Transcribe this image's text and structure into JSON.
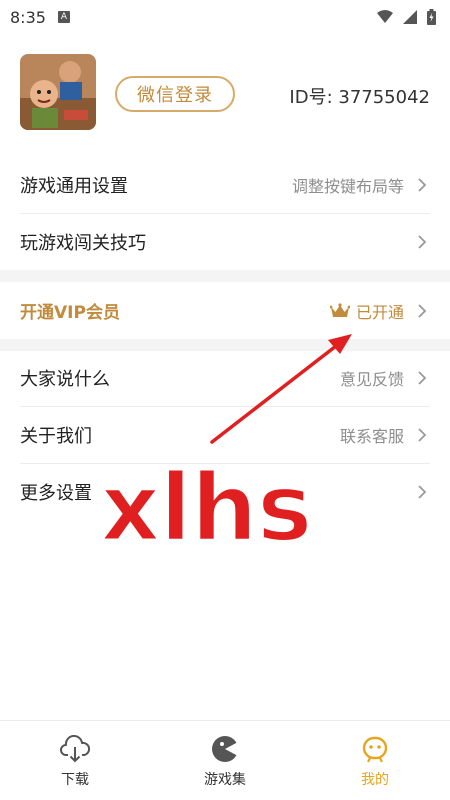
{
  "status_bar": {
    "time": "8:35",
    "notification_glyph": "A"
  },
  "profile": {
    "login_button": "微信登录",
    "user_id": "ID号: 37755042"
  },
  "menu": {
    "game_settings": {
      "label": "游戏通用设置",
      "value": "调整按键布局等"
    },
    "game_tips": {
      "label": "玩游戏闯关技巧",
      "value": ""
    },
    "vip": {
      "label": "开通VIP会员",
      "value": "已开通"
    },
    "feedback": {
      "label": "大家说什么",
      "value": "意见反馈"
    },
    "about": {
      "label": "关于我们",
      "value": "联系客服"
    },
    "more": {
      "label": "更多设置",
      "value": ""
    }
  },
  "watermark": "xlhs",
  "tabs": [
    {
      "label": "下载",
      "icon": "cloud-download-icon",
      "active": false
    },
    {
      "label": "游戏集",
      "icon": "game-collection-icon",
      "active": false
    },
    {
      "label": "我的",
      "icon": "profile-face-icon",
      "active": true
    }
  ],
  "colors": {
    "accent_gold": "#c28b3c",
    "tab_active": "#e6a51d",
    "watermark_red": "#e02020"
  }
}
